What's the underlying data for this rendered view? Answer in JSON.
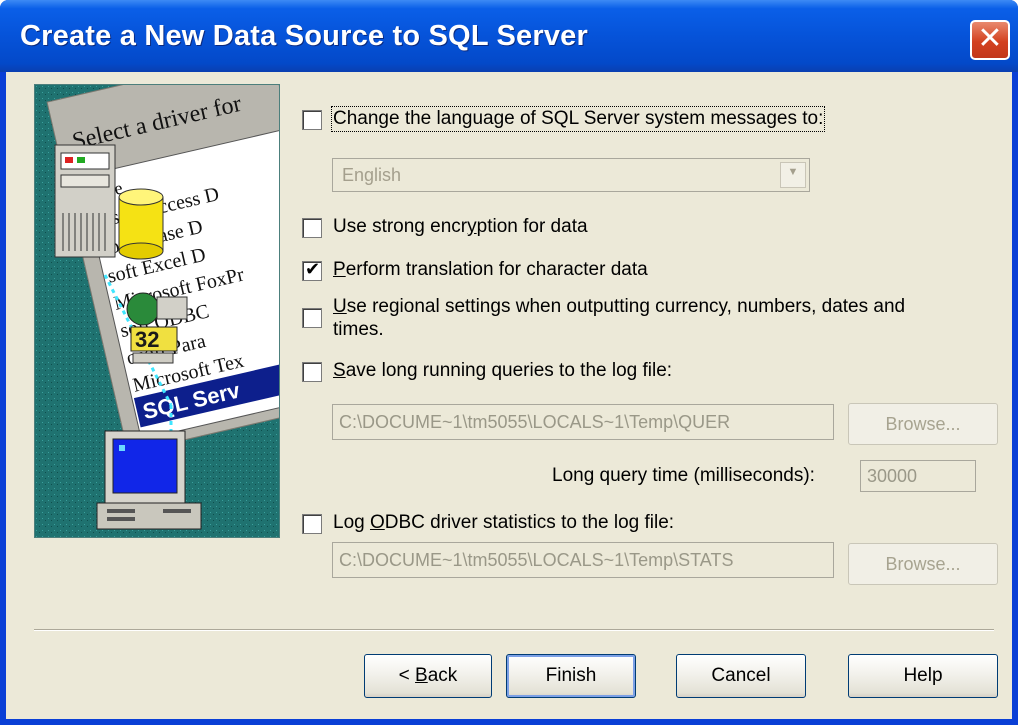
{
  "window": {
    "title": "Create a New Data Source to SQL Server",
    "close_glyph": "✕"
  },
  "artwork": {
    "header": "Select a driver for",
    "column_label": "ame",
    "drivers": [
      "rosoft Access D",
      "soft dBase D",
      "soft Excel D",
      "Microsoft FoxPr",
      "soft ODBC",
      "osoft Para",
      "Microsoft Tex",
      "SQL Serv"
    ],
    "badge": "32"
  },
  "options": {
    "change_language": {
      "label": "Change the language of SQL Server system messages to:",
      "checked": false
    },
    "language_select": {
      "value": "English"
    },
    "strong_encryption": {
      "label_pre": "Use strong encr",
      "label_accel": "y",
      "label_post": "ption for data",
      "checked": false
    },
    "translation": {
      "label_accel": "P",
      "label_post": "erform translation for character data",
      "checked": true
    },
    "regional": {
      "label_accel": "U",
      "label_line1": "se regional settings when outputting currency, numbers, dates and",
      "label_line2": "times.",
      "checked": false
    },
    "save_long_queries": {
      "label_accel": "S",
      "label_post": "ave long running queries to the log file:",
      "checked": false
    },
    "query_log_path": "C:\\DOCUME~1\\tm5055\\LOCALS~1\\Temp\\QUER",
    "query_browse": "Browse...",
    "long_query_label": "Long query time (milliseconds):",
    "long_query_value": "30000",
    "log_stats": {
      "label_pre": "Log ",
      "label_accel": "O",
      "label_post": "DBC driver statistics to the log file:",
      "checked": false
    },
    "stats_log_path": "C:\\DOCUME~1\\tm5055\\LOCALS~1\\Temp\\STATS",
    "stats_browse": "Browse..."
  },
  "buttons": {
    "back_pre": "< ",
    "back_accel": "B",
    "back_post": "ack",
    "finish": "Finish",
    "cancel": "Cancel",
    "help": "Help"
  },
  "colors": {
    "title_bar": "#0653d9",
    "dialog_face": "#ece9d8",
    "artwork_bg": "#1d6e6c"
  }
}
